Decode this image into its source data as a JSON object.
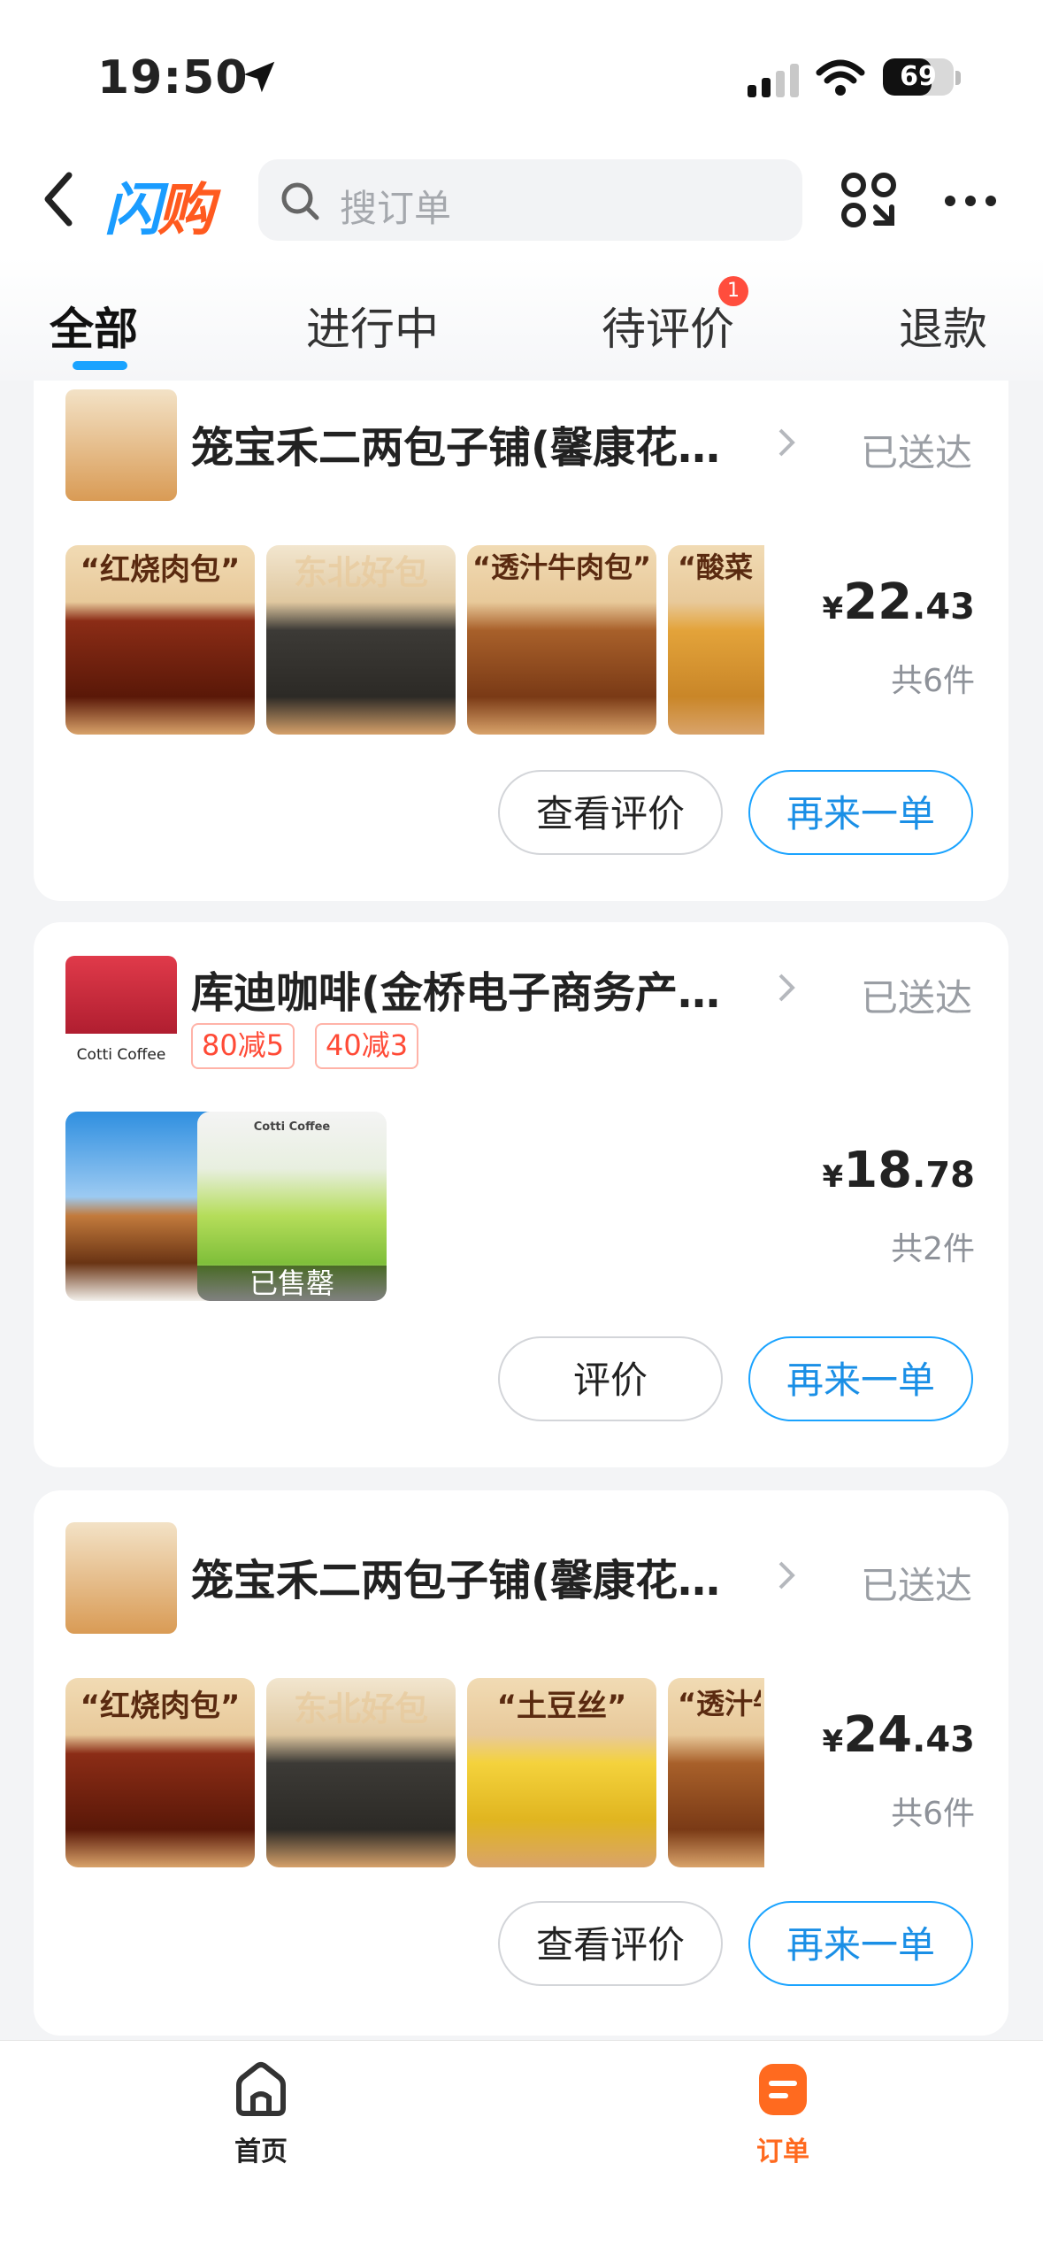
{
  "status_bar": {
    "time": "19:50",
    "battery": "69",
    "battery_level": 0.69
  },
  "header": {
    "brand_part1": "闪",
    "brand_part2": "购",
    "search_placeholder": "搜订单"
  },
  "tabs": [
    {
      "label": "全部",
      "active": true
    },
    {
      "label": "进行中"
    },
    {
      "label": "待评价",
      "badge": "1"
    },
    {
      "label": "退款"
    }
  ],
  "orders": [
    {
      "shop": "笼宝禾二两包子铺(馨康花…",
      "status": "已送达",
      "price_yen": "¥",
      "price_int": "22",
      "price_dec": ".43",
      "count": "共6件",
      "products": [
        "“红烧肉包”",
        "东北好包",
        "“透汁牛肉包”",
        "“酸菜"
      ],
      "buttons": [
        "查看评价",
        "再来一单"
      ]
    },
    {
      "shop": "库迪咖啡(金桥电子商务产…",
      "status": "已送达",
      "promos": [
        "80减5",
        "40减3"
      ],
      "price_yen": "¥",
      "price_int": "18",
      "price_dec": ".78",
      "count": "共2件",
      "logo_text": "Cotti Coffee",
      "product_brand": "Cotti Coffee",
      "soldout": "已售罄",
      "buttons": [
        "评价",
        "再来一单"
      ]
    },
    {
      "shop": "笼宝禾二两包子铺(馨康花…",
      "status": "已送达",
      "price_yen": "¥",
      "price_int": "24",
      "price_dec": ".43",
      "count": "共6件",
      "products": [
        "“红烧肉包”",
        "东北好包",
        "“土豆丝”",
        "“透汁牛"
      ],
      "buttons": [
        "查看评价",
        "再来一单"
      ]
    }
  ],
  "bottom_nav": [
    {
      "label": "首页",
      "icon": "home-icon"
    },
    {
      "label": "订单",
      "icon": "order-icon",
      "active": true
    }
  ],
  "colors": {
    "accent_blue": "#1aa3ff",
    "accent_orange": "#ff6a1f",
    "badge_red": "#ff4d3d"
  }
}
